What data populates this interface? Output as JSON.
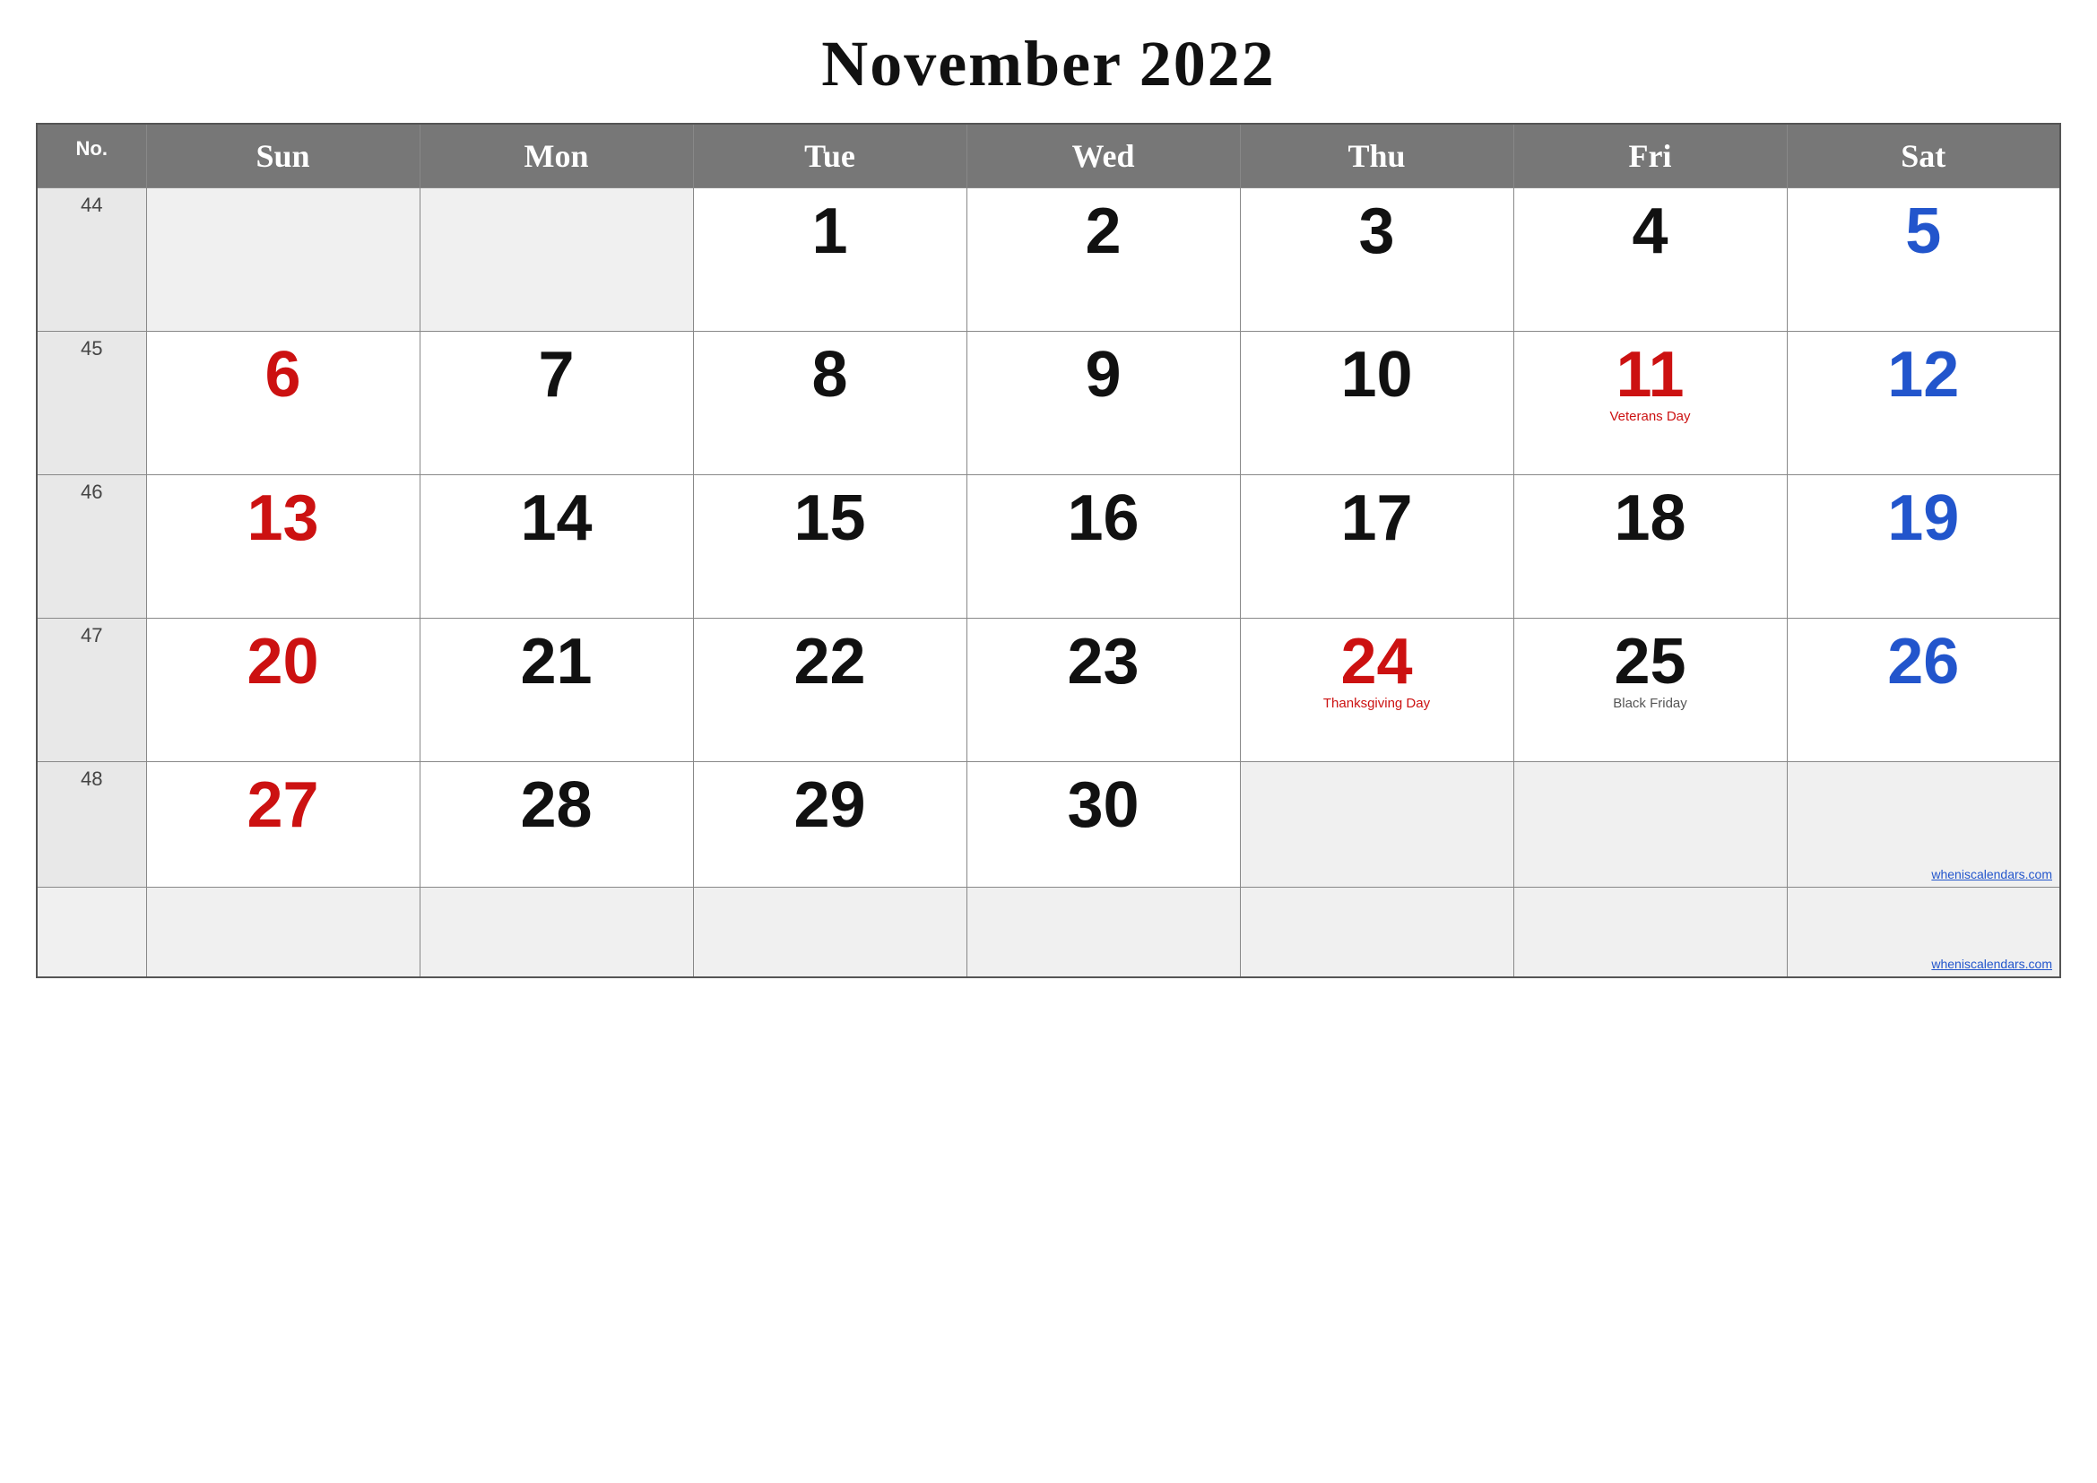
{
  "title": "November 2022",
  "headers": {
    "no": "No.",
    "sun": "Sun",
    "mon": "Mon",
    "tue": "Tue",
    "wed": "Wed",
    "thu": "Thu",
    "fri": "Fri",
    "sat": "Sat"
  },
  "weeks": [
    {
      "week_no": "44",
      "days": [
        {
          "date": "",
          "color": "empty",
          "holiday": ""
        },
        {
          "date": "",
          "color": "empty",
          "holiday": ""
        },
        {
          "date": "1",
          "color": "black",
          "holiday": ""
        },
        {
          "date": "2",
          "color": "black",
          "holiday": ""
        },
        {
          "date": "3",
          "color": "black",
          "holiday": ""
        },
        {
          "date": "4",
          "color": "black",
          "holiday": ""
        },
        {
          "date": "5",
          "color": "blue",
          "holiday": ""
        }
      ]
    },
    {
      "week_no": "45",
      "days": [
        {
          "date": "6",
          "color": "red",
          "holiday": ""
        },
        {
          "date": "7",
          "color": "black",
          "holiday": ""
        },
        {
          "date": "8",
          "color": "black",
          "holiday": ""
        },
        {
          "date": "9",
          "color": "black",
          "holiday": ""
        },
        {
          "date": "10",
          "color": "black",
          "holiday": ""
        },
        {
          "date": "11",
          "color": "red",
          "holiday": "Veterans Day"
        },
        {
          "date": "12",
          "color": "blue",
          "holiday": ""
        }
      ]
    },
    {
      "week_no": "46",
      "days": [
        {
          "date": "13",
          "color": "red",
          "holiday": ""
        },
        {
          "date": "14",
          "color": "black",
          "holiday": ""
        },
        {
          "date": "15",
          "color": "black",
          "holiday": ""
        },
        {
          "date": "16",
          "color": "black",
          "holiday": ""
        },
        {
          "date": "17",
          "color": "black",
          "holiday": ""
        },
        {
          "date": "18",
          "color": "black",
          "holiday": ""
        },
        {
          "date": "19",
          "color": "blue",
          "holiday": ""
        }
      ]
    },
    {
      "week_no": "47",
      "days": [
        {
          "date": "20",
          "color": "red",
          "holiday": ""
        },
        {
          "date": "21",
          "color": "black",
          "holiday": ""
        },
        {
          "date": "22",
          "color": "black",
          "holiday": ""
        },
        {
          "date": "23",
          "color": "black",
          "holiday": ""
        },
        {
          "date": "24",
          "color": "red",
          "holiday": "Thanksgiving Day"
        },
        {
          "date": "25",
          "color": "black",
          "holiday": "Black Friday"
        },
        {
          "date": "26",
          "color": "blue",
          "holiday": ""
        }
      ]
    },
    {
      "week_no": "48",
      "days": [
        {
          "date": "27",
          "color": "red",
          "holiday": ""
        },
        {
          "date": "28",
          "color": "black",
          "holiday": ""
        },
        {
          "date": "29",
          "color": "black",
          "holiday": ""
        },
        {
          "date": "30",
          "color": "black",
          "holiday": ""
        },
        {
          "date": "",
          "color": "empty",
          "holiday": ""
        },
        {
          "date": "",
          "color": "empty",
          "holiday": ""
        },
        {
          "date": "",
          "color": "empty",
          "holiday": ""
        }
      ]
    }
  ],
  "credit": "wheniscalendars.com"
}
